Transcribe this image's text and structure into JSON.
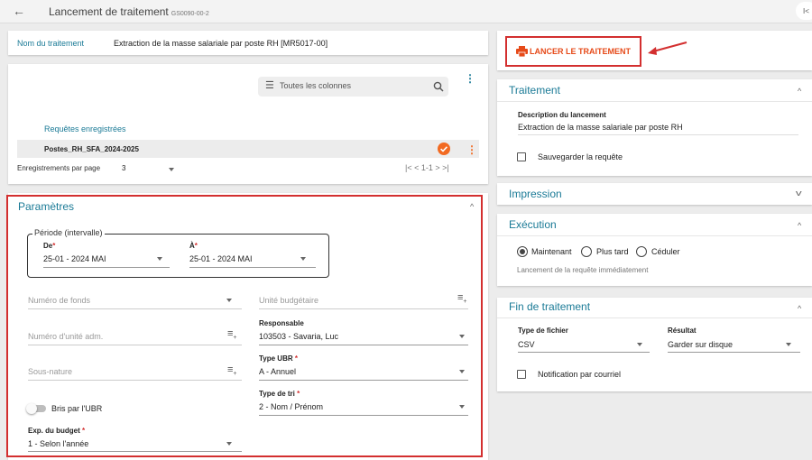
{
  "header": {
    "title": "Lancement de traitement",
    "code": "GS0090-00-2",
    "right_glyph": "I<"
  },
  "name_row": {
    "label": "Nom du traitement",
    "value": "Extraction de la masse salariale par poste RH [MR5017-00]"
  },
  "saved": {
    "search_placeholder": "Toutes les colonnes",
    "column_header": "Requêtes enregistrées",
    "rows": [
      {
        "name": "Postes_RH_SFA_2024-2025"
      }
    ],
    "per_page_label": "Enregistrements par page",
    "per_page_value": "3",
    "pagination": "1-1"
  },
  "params": {
    "title": "Paramètres",
    "period_legend": "Période (intervalle)",
    "from_label": "De",
    "from_value": "25-01 - 2024 MAI",
    "to_label": "À",
    "to_value": "25-01 - 2024 MAI",
    "fund": "Numéro de fonds",
    "budget_unit": "Unité budgétaire",
    "admin_unit": "Numéro d'unité adm.",
    "responsable_label": "Responsable",
    "responsable_value": "103503 - Savaria, Luc",
    "subnature": "Sous-nature",
    "ubr_type_label": "Type UBR",
    "ubr_type_value": "A - Annuel",
    "sort_type_label": "Type de tri",
    "sort_type_value": "2 - Nom / Prénom",
    "bris_label": "Bris par l'UBR",
    "exp_label": "Exp. du budget",
    "exp_value": "1 - Selon l'année"
  },
  "launch_label": "LANCER LE TRAITEMENT",
  "traitement": {
    "title": "Traitement",
    "desc_label": "Description du lancement",
    "desc_value": "Extraction de la masse salariale par poste RH",
    "save_label": "Sauvegarder la requête"
  },
  "impression": {
    "title": "Impression"
  },
  "execution": {
    "title": "Exécution",
    "opt_now": "Maintenant",
    "opt_later": "Plus tard",
    "opt_schedule": "Céduler",
    "note": "Lancement de la requête immédiatement"
  },
  "fin": {
    "title": "Fin de traitement",
    "file_type_label": "Type de fichier",
    "file_type_value": "CSV",
    "result_label": "Résultat",
    "result_value": "Garder sur disque",
    "notif_label": "Notification par courriel"
  },
  "colors": {
    "accent": "#1a7a96",
    "highlight": "#d32f2f",
    "launch": "#e64a19",
    "check": "#f26a21"
  }
}
